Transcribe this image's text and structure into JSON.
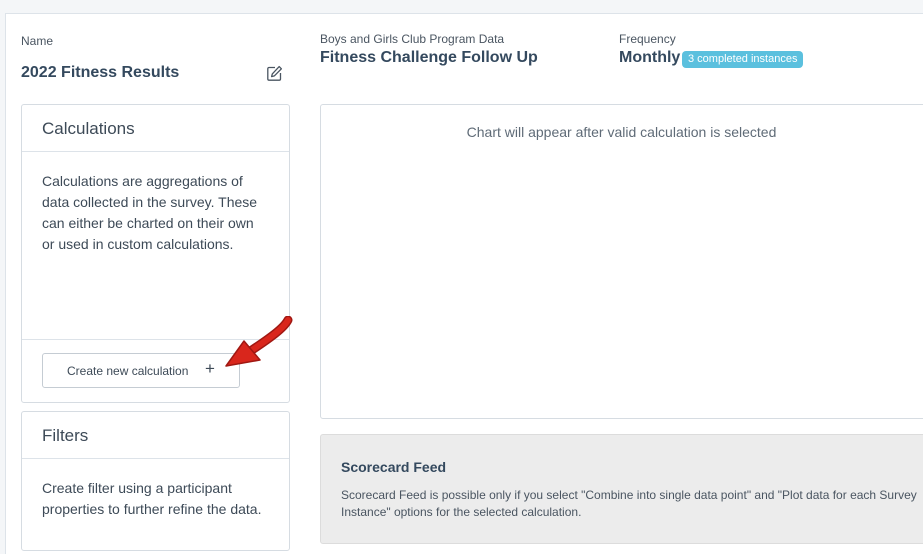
{
  "header": {
    "name_label": "Name",
    "name_value": "2022 Fitness Results",
    "program_label": "Boys and Girls Club Program Data",
    "program_value": "Fitness Challenge Follow Up",
    "frequency_label": "Frequency",
    "frequency_value": "Monthly",
    "instances_badge": "3 completed instances"
  },
  "calculations": {
    "title": "Calculations",
    "description": "Calculations are aggregations of data collected in the survey. These can either be charted on their own or used in custom calculations.",
    "create_button_label": "Create new calculation",
    "create_button_icon": "+"
  },
  "filters": {
    "title": "Filters",
    "description": "Create filter using a participant properties to further refine the data."
  },
  "chart": {
    "empty_message": "Chart will appear after valid calculation is selected"
  },
  "scorecard": {
    "title": "Scorecard Feed",
    "description": "Scorecard Feed is possible only if you select \"Combine into single data point\" and \"Plot data for each Survey Instance\" options for the selected calculation."
  },
  "colors": {
    "badge": "#5bc0de",
    "arrow": "#d9261c",
    "scorecard_bg": "#ececec"
  },
  "icons": {
    "edit": "pencil-square-icon",
    "add": "plus-icon",
    "annotation": "red-arrow-icon"
  }
}
